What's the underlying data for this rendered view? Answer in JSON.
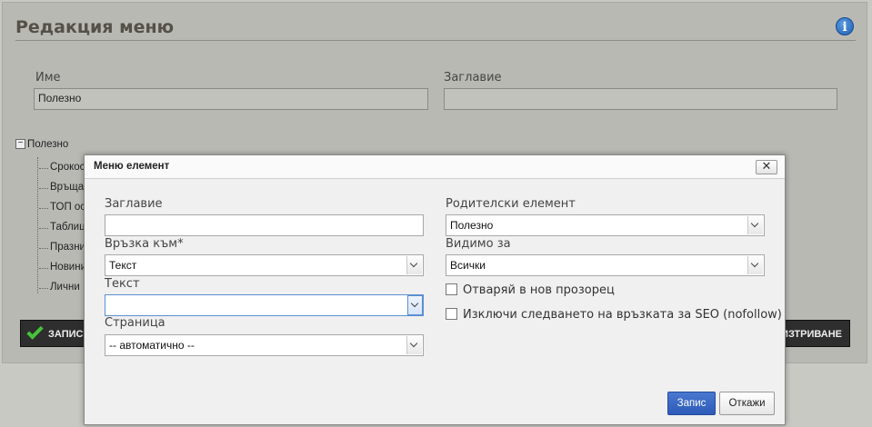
{
  "page": {
    "title": "Редакция меню",
    "name_label": "Име",
    "name_value": "Полезно",
    "caption_label": "Заглавие",
    "caption_value": ""
  },
  "tree": {
    "root": "Полезно",
    "items": [
      "Срокос",
      "Връща",
      "ТОП ос",
      "Таблиц",
      "Празни",
      "Новини",
      "Лични"
    ]
  },
  "buttons": {
    "save": "ЗАПИС",
    "delete": "ИЗТРИВАНЕ"
  },
  "modal": {
    "title": "Меню елемент",
    "close": "✕",
    "caption_label": "Заглавие",
    "caption_value": "",
    "link_to_label": "Връзка към*",
    "link_to_value": "Текст",
    "text_label": "Текст",
    "text_value": "",
    "page_label": "Страница",
    "page_value": "-- автоматично --",
    "parent_label": "Родителски елемент",
    "parent_value": "Полезно",
    "visible_label": "Видимо за",
    "visible_value": "Всички",
    "new_window_label": "Отваряй в нов прозорец",
    "nofollow_label": "Изключи следването на връзката за SEO (nofollow)",
    "save_label": "Запис",
    "cancel_label": "Откажи"
  },
  "icons": {
    "info": "info-icon",
    "check": "check-icon",
    "close": "close-icon",
    "tree_toggle": "minus-icon",
    "dropdown": "chevron-down-icon"
  },
  "colors": {
    "primary_button": "#2d5bb8",
    "save_check": "#46c23a",
    "dark_button": "#2e2e2e"
  }
}
